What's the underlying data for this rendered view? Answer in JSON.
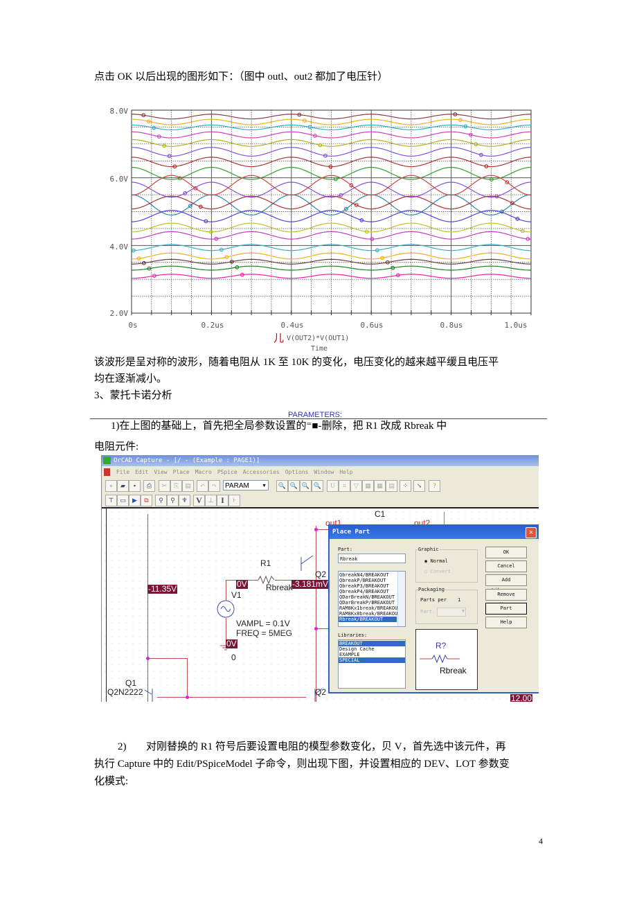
{
  "doc": {
    "intro": "点击 OK 以后出现的图形如下：（图中 outl、out2 都加了电压针）",
    "para1_line1": "该波形是呈对称的波形，随着电阻从 1K 至 10K 的变化，电压变化的越来越平缓且电压平",
    "para1_line2": "均在逐渐减小。",
    "section": "3、蒙托卡诺分析",
    "parameters_label": "PARAMETERS:",
    "step1_line1": "1)在上图的基础上，首先把全局参数设置的⁼■-删除，把 R1 改成 Rbreak 中",
    "step1_line2": "电阻元件:",
    "step2_num": "2)",
    "step2_line1": "对刚替换的 R1 符号后要设置电阻的模型参数变化，贝 V，首先选中该元件，再",
    "step2_line2": "执行 Capture 中的 Edit/PSpiceModel 子命令，则出现下图，并设置相应的 DEV、LOT 参数变",
    "step2_line3": "化模式:",
    "page_number": "4"
  },
  "chart_data": {
    "type": "line",
    "xlabel": "Time",
    "legend_marker": "儿",
    "legend": "V(OUT2)*V(OUT1)",
    "xlim": [
      0,
      1.0
    ],
    "x_unit": "us",
    "ylim": [
      2.0,
      8.0
    ],
    "x_ticks": [
      "0s",
      "0.2us",
      "0.4us",
      "0.6us",
      "0.8us",
      "1.0us"
    ],
    "y_ticks": [
      "2.0V",
      "4.0V",
      "6.0V",
      "8.0V"
    ],
    "grid": true,
    "frequency_hz": 5000000,
    "series_model": "v(t) = mean + sign * amplitude * cos(2*pi*f*t)",
    "series": [
      {
        "mean": 7.81,
        "amplitude": 0.07,
        "sign": 1,
        "color": "#8b3a3a"
      },
      {
        "mean": 7.65,
        "amplitude": 0.08,
        "sign": 1,
        "color": "#f0b020"
      },
      {
        "mean": 7.49,
        "amplitude": 0.07,
        "sign": 1,
        "color": "#30b0c0"
      },
      {
        "mean": 7.27,
        "amplitude": 0.09,
        "sign": 1,
        "color": "#d040c0"
      },
      {
        "mean": 7.03,
        "amplitude": 0.1,
        "sign": 1,
        "color": "#b0b020"
      },
      {
        "mean": 6.77,
        "amplitude": 0.13,
        "sign": 1,
        "color": "#8050e0"
      },
      {
        "mean": 6.47,
        "amplitude": 0.14,
        "sign": 1,
        "color": "#b03030"
      },
      {
        "mean": 6.13,
        "amplitude": 0.18,
        "sign": 1,
        "color": "#30a030"
      },
      {
        "mean": 5.65,
        "amplitude": 0.22,
        "sign": 1,
        "color": "#8050e0"
      },
      {
        "mean": 5.2,
        "amplitude": 0.3,
        "sign": 1,
        "color": "#3080b0"
      },
      {
        "mean": 5.78,
        "amplitude": 0.29,
        "sign": -1,
        "color": "#d04040"
      },
      {
        "mean": 5.27,
        "amplitude": 0.19,
        "sign": -1,
        "color": "#b03030"
      },
      {
        "mean": 4.87,
        "amplitude": 0.17,
        "sign": -1,
        "color": "#5040e0"
      },
      {
        "mean": 4.53,
        "amplitude": 0.13,
        "sign": -1,
        "color": "#c0c030"
      },
      {
        "mean": 4.3,
        "amplitude": 0.11,
        "sign": -1,
        "color": "#c040c0"
      },
      {
        "mean": 3.94,
        "amplitude": 0.09,
        "sign": -1,
        "color": "#30b0c0"
      },
      {
        "mean": 3.69,
        "amplitude": 0.09,
        "sign": -1,
        "color": "#f0b020"
      },
      {
        "mean": 3.52,
        "amplitude": 0.07,
        "sign": -1,
        "color": "#6a3a3a"
      },
      {
        "mean": 3.33,
        "amplitude": 0.06,
        "sign": -1,
        "color": "#208020"
      },
      {
        "mean": 3.09,
        "amplitude": 0.06,
        "sign": -1,
        "color": "#f020a0"
      }
    ]
  },
  "app": {
    "title": "OrCAD Capture - [/ - (Example : PAGE1)]",
    "menu": [
      "File",
      "Edit",
      "View",
      "Place",
      "Macro",
      "PSpice",
      "Accessories",
      "Options",
      "Window",
      "Help"
    ],
    "toolbar_combo": "PARAM",
    "schematic": {
      "v_neg": "-11.35V",
      "v_zero1": "0V",
      "v_mid": "-3.181mV",
      "v_zero2": "0V",
      "r1": "R1",
      "r1_model": "Rbreak",
      "v1": "V1",
      "vampl": "VAMPL = 0.1V",
      "freq": "FREQ = 5MEG",
      "ground": "0",
      "q1": "Q1",
      "q1_model": "Q2N2222",
      "q2_top": "Q2",
      "q2_bot": "Q2",
      "out1": "out1",
      "out2": "out2",
      "c1": "C1",
      "v_right": "12.00"
    },
    "dialog": {
      "title": "Place Part",
      "part_label": "Part:",
      "part_value": "Rbreak",
      "parts": [
        "QbreakN4/BREAKOUT",
        "QbreakP/BREAKOUT",
        "QbreakP3/BREAKOUT",
        "QbreakP4/BREAKOUT",
        "QDarBreakN/BREAKOUT",
        "QDarBreakP/BREAKOUT",
        "RAM8Kx1break/BREAKOUT",
        "RAM8Kx8break/BREAKOUT",
        "Rbreak/BREAKOUT"
      ],
      "libraries_label": "Libraries:",
      "libraries": [
        "BREAKOUT",
        "Design Cache",
        "EXAMPLE",
        "SPECIAL"
      ],
      "graphic_label": "Graphic",
      "normal": "Normal",
      "convert": "Convert",
      "packaging_label": "Packaging",
      "parts_per": "Parts per",
      "parts_per_value": "1",
      "part_field": "Part:",
      "preview_ref": "R?",
      "preview_name": "Rbreak",
      "buttons": [
        "OK",
        "Cancel",
        "Add Library...",
        "Remove Library",
        "Part Search...",
        "Help"
      ]
    }
  }
}
